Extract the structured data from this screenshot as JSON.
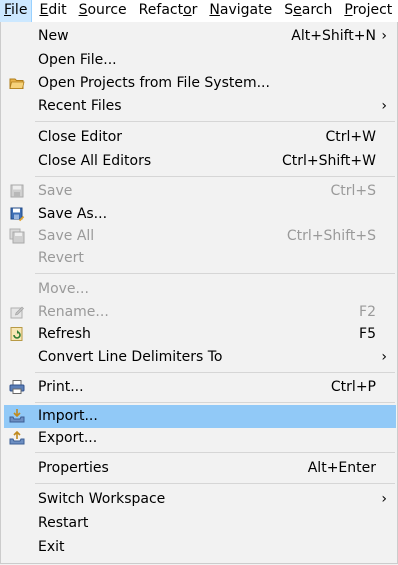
{
  "menubar": [
    {
      "label": "File",
      "mnemonic_index": 0,
      "active": true
    },
    {
      "label": "Edit",
      "mnemonic_index": 0
    },
    {
      "label": "Source",
      "mnemonic_index": 0
    },
    {
      "label": "Refactor",
      "mnemonic_index": 6
    },
    {
      "label": "Navigate",
      "mnemonic_index": 0
    },
    {
      "label": "Search",
      "mnemonic_index": 1
    },
    {
      "label": "Project",
      "mnemonic_index": 0
    }
  ],
  "file_menu": {
    "new": {
      "label": "New",
      "shortcut": "Alt+Shift+N",
      "submenu": "›"
    },
    "open_file": {
      "label": "Open File..."
    },
    "open_projects": {
      "label": "Open Projects from File System...",
      "icon": "folder-icon"
    },
    "recent_files": {
      "label": "Recent Files",
      "submenu": "›"
    },
    "close_editor": {
      "label": "Close Editor",
      "shortcut": "Ctrl+W"
    },
    "close_all_editors": {
      "label": "Close All Editors",
      "shortcut": "Ctrl+Shift+W"
    },
    "save": {
      "label": "Save",
      "shortcut": "Ctrl+S",
      "icon": "save-icon",
      "enabled": false
    },
    "save_as": {
      "label": "Save As...",
      "icon": "save-as-icon"
    },
    "save_all": {
      "label": "Save All",
      "shortcut": "Ctrl+Shift+S",
      "icon": "save-all-icon",
      "enabled": false
    },
    "revert": {
      "label": "Revert",
      "enabled": false
    },
    "move": {
      "label": "Move...",
      "enabled": false
    },
    "rename": {
      "label": "Rename...",
      "shortcut": "F2",
      "icon": "rename-icon",
      "enabled": false
    },
    "refresh": {
      "label": "Refresh",
      "shortcut": "F5",
      "icon": "refresh-icon"
    },
    "convert_line_delimiters": {
      "label": "Convert Line Delimiters To",
      "submenu": "›"
    },
    "print": {
      "label": "Print...",
      "shortcut": "Ctrl+P",
      "icon": "print-icon"
    },
    "import": {
      "label": "Import...",
      "icon": "import-icon",
      "highlighted": true
    },
    "export": {
      "label": "Export...",
      "icon": "export-icon"
    },
    "properties": {
      "label": "Properties",
      "shortcut": "Alt+Enter"
    },
    "switch_workspace": {
      "label": "Switch Workspace",
      "submenu": "›"
    },
    "restart": {
      "label": "Restart"
    },
    "exit": {
      "label": "Exit"
    }
  },
  "colors": {
    "highlight": "#91c9f7",
    "menu_background": "#f2f2f2",
    "disabled_text": "#9a9a9a",
    "menubar_active": "#cce8ff"
  }
}
